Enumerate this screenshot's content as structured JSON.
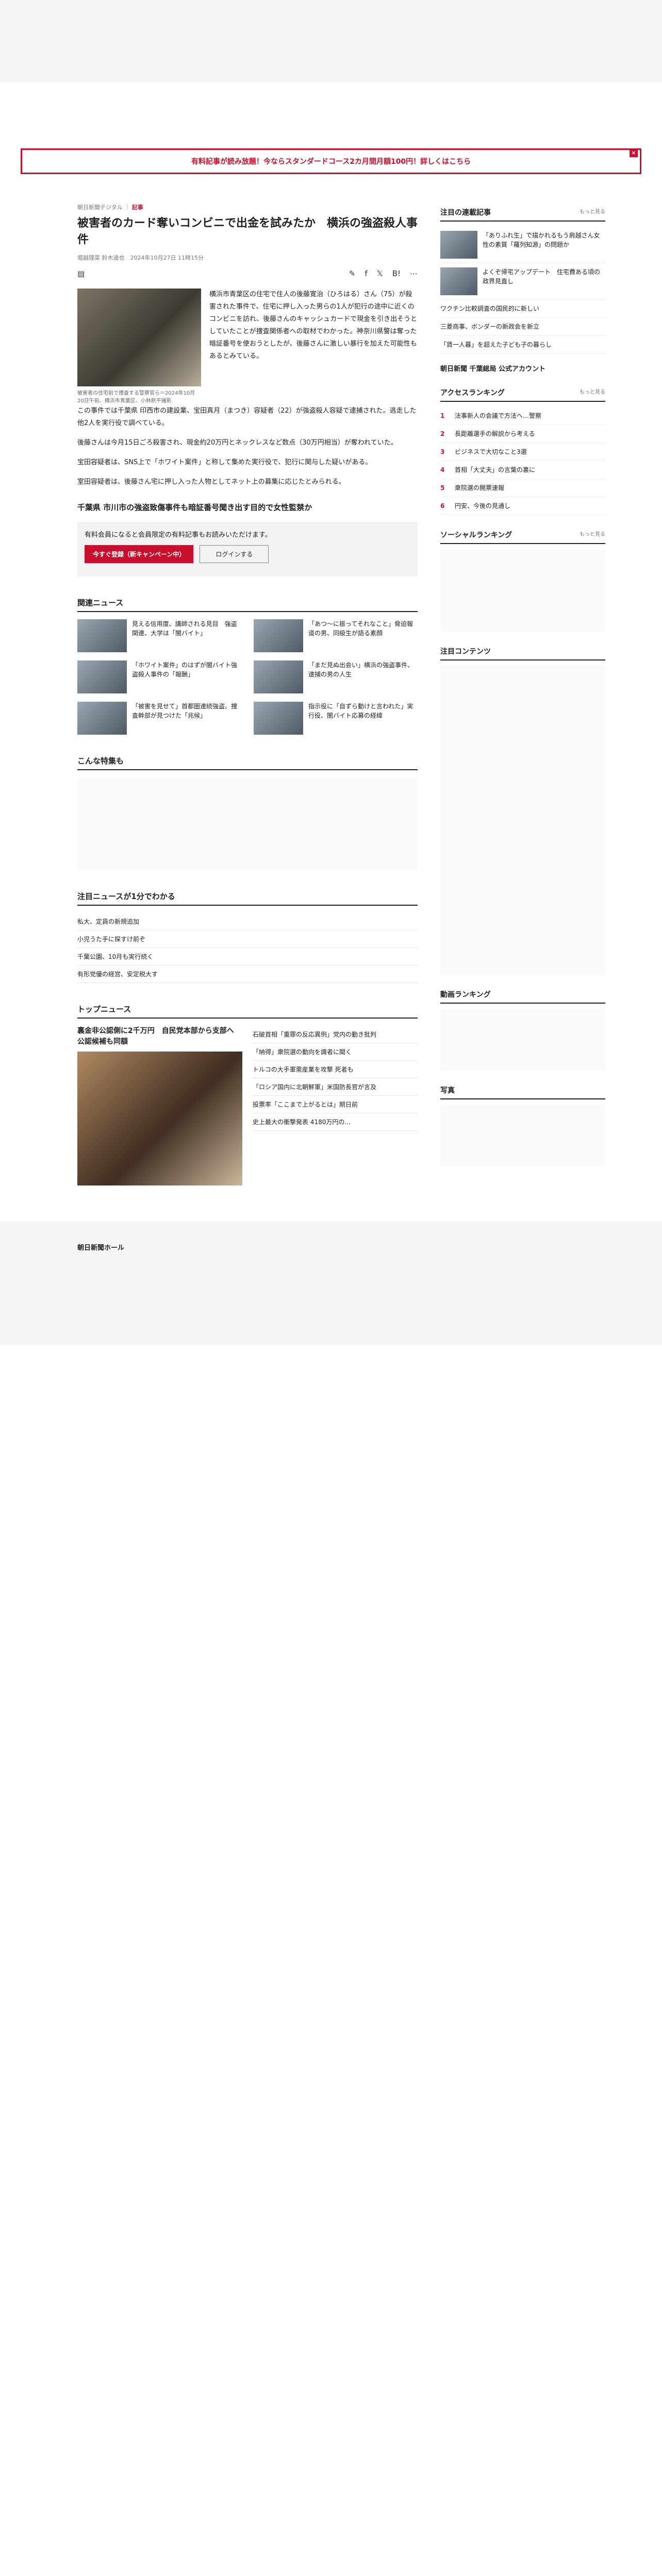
{
  "banner": {
    "text": "有料記事が読み放題！今ならスタンダードコース2カ月間月額100円！詳しくはこちら",
    "close": "×"
  },
  "article": {
    "crumb_section": "朝日新聞デジタル",
    "crumb_tag": "記事",
    "title": "被害者のカード奪いコンビニで出金を試みたか　横浜の強盗殺人事件",
    "byline": "堀越理菜 鈴木達也　2024年10月27日 11時15分",
    "photo_caption": "被害者の住宅前で捜査する警察官ら＝2024年10月20日午前、横浜市青葉区、小林航平撮影",
    "paragraphs": [
      "横浜市青葉区の住宅で住人の後藤寛治（ひろはる）さん（75）が殺害された事件で、住宅に押し入った男らの1人が犯行の途中に近くのコンビニを訪れ、後藤さんのキャッシュカードで現金を引き出そうとしていたことが捜査関係者への取材でわかった。神奈川県警は奪った暗証番号を使おうとしたが、後藤さんに激しい暴行を加えた可能性もあるとみている。",
      "この事件では千葉県 印西市の建設業、宝田真月（まつき）容疑者（22）が強盗殺人容疑で逮捕された。逃走した他2人を実行役で調べている。",
      "後藤さんは今月15日ごろ殺害され、現金約20万円とネックレスなど数点（30万円相当）が奪われていた。",
      "宝田容疑者は、SNS上で「ホワイト案件」と称して集めた実行役で、犯行に関与した疑いがある。",
      "室田容疑者は、後藤さん宅に押し入った人物としてネット上の募集に応じたとみられる。"
    ],
    "ad_text": "有料会員になると会員限定の有料記事もお読みいただけます。",
    "btn_register": "今すぐ登録（新キャンペーン中）",
    "btn_login": "ログインする",
    "subhead": "千葉県 市川市の強盗致傷事件も暗証番号聞き出す目的で女性監禁か"
  },
  "related": {
    "title": "関連ニュース",
    "items": [
      "見える信用度、講師される見目　強盗関連、大学は「闇バイト」",
      "「あつ〜に振ってそれなこと」脅迫報道の男、同級生が語る素顔",
      "「ホワイト案件」のはずが闇バイト強盗殺人事件の「報酬」",
      "「まだ見ぬ出会い」横浜の強盗事件、逮捕の男の人生",
      "「被害を見せて」首都圏連続強盗、捜査幹部が見つけた「兆候」",
      "指示役に「自ずら動けと言われた」実行役、闇バイト応募の経緯"
    ]
  },
  "special": {
    "title": "こんな特集も"
  },
  "news": {
    "title": "注目ニュースが1分でわかる",
    "items": [
      "私大、定員の新規追加",
      "小児うた手に探すけ前ぞ",
      "千葉公園、10月も実行続く",
      "有形党優の経営、安定税大す"
    ]
  },
  "top": {
    "title": "トップニュース",
    "main": "裏金非公認側に2千万円　自民党本部から支部へ　公認候補も同額",
    "items": [
      "石破首相「重罪の反応異例」党内の動き批判",
      "「納得」衆院選の動向を識者に聞く",
      "トルコの大手軍需産業を攻撃 死者も",
      "「ロシア国内に北朝鮮軍」米国防長官が言及",
      "投票率「ここまで上がるとは」期日前",
      "史上最大の衝撃発表 4180万円の…"
    ]
  },
  "sidebar": {
    "ranking_title": "注目の連載記事",
    "more": "もっと見る",
    "ranking": [
      "「ありふれ生」で描かれるもう肩越さん女性の素質「羅列知源」の問題か",
      "よくぞ帰宅アップデート　住宅費ある頃の政界見直し",
      "ワクチン比較調査の国民的に新しい",
      "三菱商事、ボンダーの新政会を新立",
      "「賃一人暮」を超えた子ども子の暮らし"
    ],
    "follow": "朝日新聞 千葉総局 公式アカウント",
    "access_title": "アクセスランキング",
    "access": [
      "法事新人の会議で方法へ…警察",
      "長距離選手の解説から考える",
      "ビジネスで大切なこと3選",
      "首相「大丈夫」の言葉の裏に",
      "衆院選の開票速報",
      "円安、今後の見通し"
    ],
    "social_title": "ソーシャルランキング",
    "content_title": "注目コンテンツ",
    "video_title": "動画ランキング",
    "photo_title": "写真"
  },
  "footer": {
    "logo": "朝日新聞ホール"
  }
}
